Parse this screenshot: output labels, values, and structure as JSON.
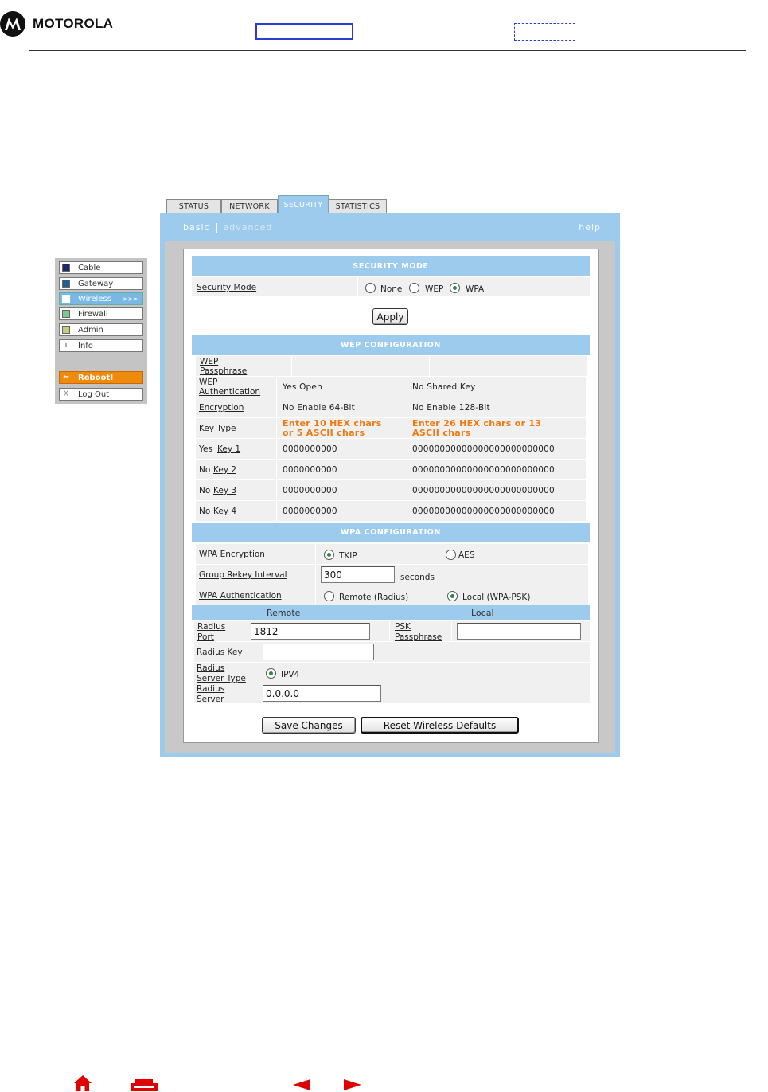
{
  "brand": {
    "name": "MOTOROLA"
  },
  "tabs": [
    "STATUS",
    "NETWORK",
    "SECURITY",
    "STATISTICS"
  ],
  "subnav": {
    "basic": "basic",
    "advanced": "advanced",
    "help": "help"
  },
  "menu": {
    "items": [
      {
        "label": "Cable",
        "color": "#1b2a6b"
      },
      {
        "label": "Gateway",
        "color": "#1f5f93"
      },
      {
        "label": "Wireless",
        "color": "#ffffff",
        "more": ">>>"
      },
      {
        "label": "Firewall",
        "color": "#7ec98a"
      },
      {
        "label": "Admin",
        "color": "#c8c87e"
      },
      {
        "label": "Info",
        "glyph": "i"
      },
      {
        "label": "Reboot!",
        "glyph": "⇐"
      },
      {
        "label": "Log Out",
        "glyph": "X"
      }
    ]
  },
  "security_mode": {
    "header": "SECURITY MODE",
    "label": "Security Mode",
    "options": [
      "None",
      "WEP",
      "WPA"
    ],
    "selected": "WPA",
    "apply": "Apply"
  },
  "wep": {
    "header": "WEP CONFIGURATION",
    "passphrase_label": "WEP Passphrase",
    "passphrase_l1": "WEP",
    "passphrase_l2": "Passphrase",
    "auth_l1": "WEP",
    "auth_l2": "Authentication",
    "auth_open": "Yes Open",
    "auth_shared": "No Shared Key",
    "enc_label": "Encryption",
    "enc_64": "No Enable 64-Bit",
    "enc_128": "No Enable 128-Bit",
    "keytype_label": "Key Type",
    "hint64_l1": "Enter 10 HEX chars",
    "hint64_l2": "or 5 ASCII chars",
    "hint128_l1": "Enter 26 HEX chars or 13",
    "hint128_l2": "ASCII chars",
    "keys": [
      {
        "prefix": "Yes",
        "name": "Key 1",
        "v64": "0000000000",
        "v128": "00000000000000000000000000"
      },
      {
        "prefix": "No",
        "name": "Key 2",
        "v64": "0000000000",
        "v128": "00000000000000000000000000"
      },
      {
        "prefix": "No",
        "name": "Key 3",
        "v64": "0000000000",
        "v128": "00000000000000000000000000"
      },
      {
        "prefix": "No",
        "name": "Key 4",
        "v64": "0000000000",
        "v128": "00000000000000000000000000"
      }
    ]
  },
  "wpa": {
    "header": "WPA CONFIGURATION",
    "enc_label": "WPA Encryption",
    "tkip": "TKIP",
    "aes": "AES",
    "rekey_label": "Group Rekey Interval",
    "rekey_value": "300",
    "rekey_unit": "seconds",
    "auth_label": "WPA Authentication",
    "auth_remote": "Remote (Radius)",
    "auth_local": "Local (WPA-PSK)",
    "remote_header": "Remote",
    "local_header": "Local",
    "radius_port_l1": "Radius",
    "radius_port_l2": "Port",
    "radius_port_value": "1812",
    "psk_l1": "PSK",
    "psk_l2": "Passphrase",
    "psk_value": "",
    "radius_key_label": "Radius Key",
    "radius_key_value": "",
    "server_type_l1": "Radius",
    "server_type_l2": "Server Type",
    "server_type_option": "IPV4",
    "server_l1": "Radius",
    "server_l2": "Server",
    "server_value": "0.0.0.0"
  },
  "buttons": {
    "save": "Save Changes",
    "reset": "Reset Wireless Defaults"
  },
  "footer": {
    "icons": [
      "home-icon",
      "print-icon",
      "previous-arrow-icon",
      "next-arrow-icon"
    ]
  }
}
